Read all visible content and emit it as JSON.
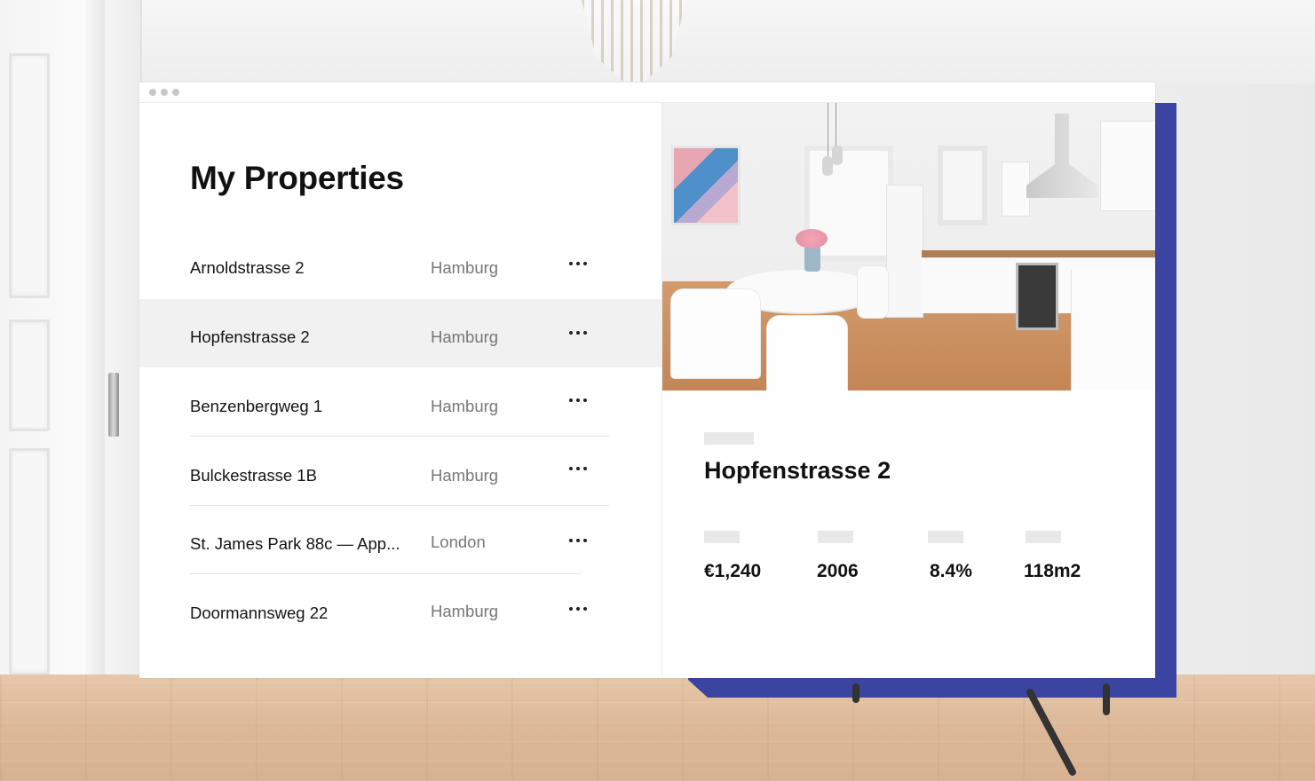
{
  "page_title": "My Properties",
  "properties": [
    {
      "name": "Arnoldstrasse 2",
      "city": "Hamburg"
    },
    {
      "name": "Hopfenstrasse 2",
      "city": "Hamburg"
    },
    {
      "name": "Benzenbergweg 1",
      "city": "Hamburg"
    },
    {
      "name": "Bulckestrasse 1B",
      "city": "Hamburg"
    },
    {
      "name": "St. James Park 88c — App...",
      "city": "London"
    },
    {
      "name": "Doormannsweg 22",
      "city": "Hamburg"
    }
  ],
  "selected_property": {
    "title": "Hopfenstrasse 2",
    "stats": [
      {
        "value": "€1,240"
      },
      {
        "value": "2006"
      },
      {
        "value": "8.4%"
      },
      {
        "value": "118m2"
      }
    ]
  },
  "icons": {
    "row_menu": "more-horizontal-icon",
    "window_controls": "window-dots-icon"
  },
  "colors": {
    "accent": "#3b44a0",
    "selected_row": "#f1f1f1"
  }
}
